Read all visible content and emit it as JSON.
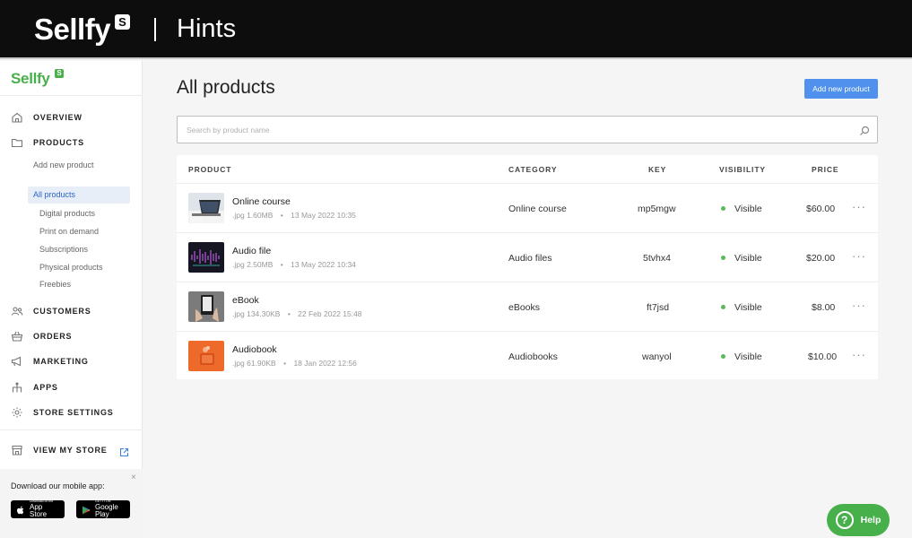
{
  "banner": {
    "logo": "Sellfy",
    "logo_badge": "S",
    "title": "Hints"
  },
  "sidebar": {
    "logo": "Sellfy",
    "logo_badge": "S",
    "nav": {
      "overview": "OVERVIEW",
      "products": "PRODUCTS",
      "add_new_product": "Add new product",
      "all_products": "All products",
      "digital_products": "Digital products",
      "print_on_demand": "Print on demand",
      "subscriptions": "Subscriptions",
      "physical_products": "Physical products",
      "freebies": "Freebies",
      "customers": "CUSTOMERS",
      "orders": "ORDERS",
      "marketing": "MARKETING",
      "apps": "APPS",
      "store_settings": "STORE SETTINGS",
      "view_my_store": "VIEW MY STORE"
    },
    "mobile": {
      "title": "Download our mobile app:",
      "close": "×",
      "app_store_small": "Download on the",
      "app_store": "App Store",
      "google_play_small": "GET IT ON",
      "google_play": "Google Play"
    }
  },
  "main": {
    "title": "All products",
    "add_button": "Add new product",
    "search_placeholder": "Search by product name",
    "columns": {
      "product": "PRODUCT",
      "category": "CATEGORY",
      "key": "KEY",
      "visibility": "VISIBILITY",
      "price": "PRICE"
    },
    "rows": [
      {
        "name": "Online course",
        "type": ".jpg",
        "size": "1.60MB",
        "date": "13 May 2022 10:35",
        "category": "Online course",
        "key": "mp5mgw",
        "visibility": "Visible",
        "price": "$60.00",
        "more": "···",
        "thumb": "laptop-photo"
      },
      {
        "name": "Audio file",
        "type": ".jpg",
        "size": "2.50MB",
        "date": "13 May 2022 10:34",
        "category": "Audio files",
        "key": "5tvhx4",
        "visibility": "Visible",
        "price": "$20.00",
        "more": "···",
        "thumb": "audio-waveform-photo"
      },
      {
        "name": "eBook",
        "type": ".jpg",
        "size": "134.30KB",
        "date": "22 Feb 2022 15:48",
        "category": "eBooks",
        "key": "ft7jsd",
        "visibility": "Visible",
        "price": "$8.00",
        "more": "···",
        "thumb": "ereader-photo"
      },
      {
        "name": "Audiobook",
        "type": ".jpg",
        "size": "61.90KB",
        "date": "18 Jan 2022 12:56",
        "category": "Audiobooks",
        "key": "wanyol",
        "visibility": "Visible",
        "price": "$10.00",
        "more": "···",
        "thumb": "orange-audiobook-photo"
      }
    ]
  },
  "help": {
    "label": "Help",
    "icon": "?"
  },
  "colors": {
    "accent_blue": "#4f91ec",
    "brand_green": "#48b04b",
    "visible_dot": "#5cb85c",
    "active_nav_bg": "#e8eef8"
  }
}
